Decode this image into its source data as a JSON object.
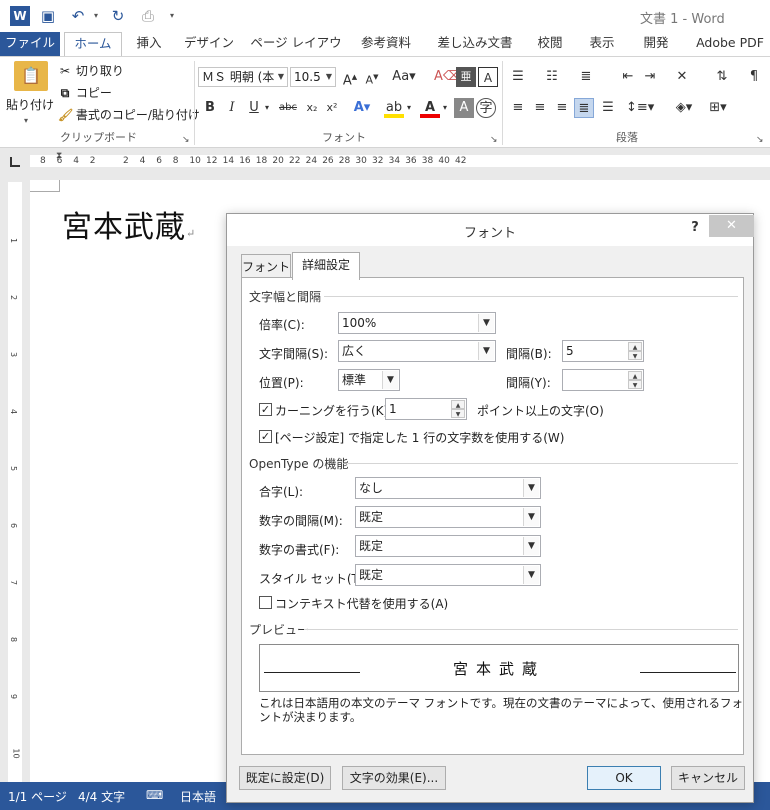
{
  "window": {
    "title": "文書 1 - Word"
  },
  "ribbon_tabs": [
    "ファイル",
    "ホーム",
    "挿入",
    "デザイン",
    "ページ レイアウト",
    "参考資料",
    "差し込み文書",
    "校閲",
    "表示",
    "開発",
    "Adobe PDF"
  ],
  "clipboard": {
    "paste": "貼り付け",
    "cut": "切り取り",
    "copy": "コピー",
    "format_painter": "書式のコピー/貼り付け",
    "group_label": "クリップボード"
  },
  "font_group": {
    "font_name": "ＭＳ 明朝 (本",
    "font_size": "10.5",
    "group_label": "フォント",
    "bold": "B",
    "italic": "I",
    "underline": "U",
    "strike": "abc",
    "sub": "x₂",
    "sup": "x²"
  },
  "paragraph_group": {
    "group_label": "段落"
  },
  "ruler_numbers": [
    "8",
    "6",
    "4",
    "2",
    "",
    "2",
    "4",
    "6",
    "8",
    "10",
    "12",
    "14",
    "16",
    "18",
    "20",
    "22",
    "24",
    "26",
    "28",
    "30",
    "32",
    "34",
    "36",
    "38",
    "40",
    "42"
  ],
  "vruler_numbers": [
    "1",
    "2",
    "3",
    "4",
    "5",
    "6",
    "7",
    "8",
    "9",
    "10"
  ],
  "document": {
    "text": "宮本武蔵"
  },
  "status": {
    "page": "1/1 ページ",
    "words": "4/4 文字",
    "lang": "日本語"
  },
  "dialog": {
    "title": "フォント",
    "help": "?",
    "close": "✕",
    "tabs": [
      "フォント",
      "詳細設定"
    ],
    "section_spacing": "文字幅と間隔",
    "scale_label": "倍率(C):",
    "scale_value": "100%",
    "spacing_label": "文字間隔(S):",
    "spacing_value": "広く",
    "spacing_by_label": "間隔(B):",
    "spacing_by_value": "5",
    "position_label": "位置(P):",
    "position_value": "標準",
    "position_by_label": "間隔(Y):",
    "position_by_value": "",
    "kerning_label": "カーニングを行う(K):",
    "kerning_value": "1",
    "kerning_suffix": "ポイント以上の文字(O)",
    "grid_label": "[ページ設定] で指定した 1 行の文字数を使用する(W)",
    "section_opentype": "OpenType の機能",
    "ligatures_label": "合字(L):",
    "ligatures_value": "なし",
    "numspacing_label": "数字の間隔(M):",
    "numspacing_value": "既定",
    "numforms_label": "数字の書式(F):",
    "numforms_value": "既定",
    "stylesets_label": "スタイル セット(T):",
    "stylesets_value": "既定",
    "contextual_label": "コンテキスト代替を使用する(A)",
    "section_preview": "プレビュー",
    "preview_text": "宮本武蔵",
    "preview_note": "これは日本語用の本文のテーマ フォントです。現在の文書のテーマによって、使用されるフォントが決まります。",
    "set_default": "既定に設定(D)",
    "text_effects": "文字の効果(E)...",
    "ok": "OK",
    "cancel": "キャンセル"
  }
}
